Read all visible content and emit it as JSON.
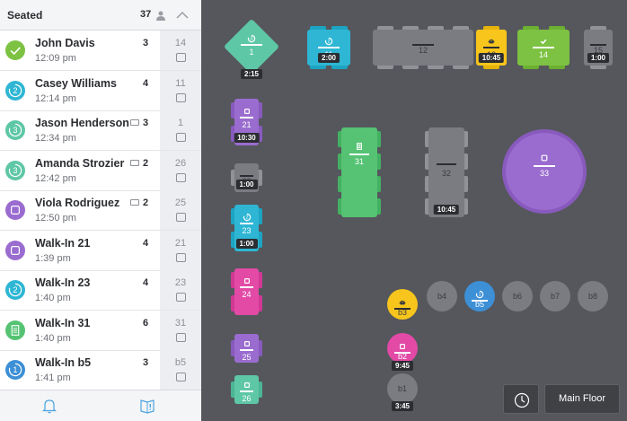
{
  "sidebar": {
    "title": "Seated",
    "guest_count": "37",
    "guests": [
      {
        "name": "John Davis",
        "time": "12:09 pm",
        "party": "3",
        "table": "14",
        "has_note": false,
        "status": "check",
        "color": "#7dc243"
      },
      {
        "name": "Casey Williams",
        "time": "12:14 pm",
        "party": "4",
        "table": "11",
        "has_note": false,
        "status": "course-2",
        "color": "#2eb6d4"
      },
      {
        "name": "Jason Henderson",
        "time": "12:34 pm",
        "party": "3",
        "table": "1",
        "has_note": true,
        "status": "course-3",
        "color": "#5ec7a6"
      },
      {
        "name": "Amanda Strozier",
        "time": "12:42 pm",
        "party": "2",
        "table": "26",
        "has_note": true,
        "status": "course-3",
        "color": "#5ec7a6"
      },
      {
        "name": "Viola Rodriguez",
        "time": "12:50 pm",
        "party": "2",
        "table": "25",
        "has_note": true,
        "status": "empty-plate",
        "color": "#9a6ccf"
      },
      {
        "name": "Walk-In 21",
        "time": "1:39 pm",
        "party": "4",
        "table": "21",
        "has_note": false,
        "status": "empty-plate",
        "color": "#9a6ccf"
      },
      {
        "name": "Walk-In 23",
        "time": "1:40 pm",
        "party": "4",
        "table": "23",
        "has_note": false,
        "status": "course-2",
        "color": "#2eb6d4"
      },
      {
        "name": "Walk-In 31",
        "time": "1:40 pm",
        "party": "6",
        "table": "31",
        "has_note": false,
        "status": "menu",
        "color": "#55c373"
      },
      {
        "name": "Walk-In b5",
        "time": "1:41 pm",
        "party": "3",
        "table": "b5",
        "has_note": false,
        "status": "course-1",
        "color": "#3d8fd6"
      }
    ],
    "footer_icons": [
      "bell-icon",
      "book-alert-icon"
    ]
  },
  "floor": {
    "tables": [
      {
        "id": "1",
        "timer": "2:15",
        "status": "course-3",
        "color": "#5ec7a6"
      },
      {
        "id": "11",
        "timer": "2:00",
        "status": "course-2",
        "color": "#2eb6d4"
      },
      {
        "id": "12",
        "timer": "",
        "status": "empty",
        "color": "#7a7c82"
      },
      {
        "id": "13",
        "timer": "10:45",
        "status": "dessert",
        "color": "#f7c51c"
      },
      {
        "id": "14",
        "timer": "",
        "status": "check",
        "color": "#7dc243"
      },
      {
        "id": "15",
        "timer": "1:00",
        "status": "empty",
        "color": "#7a7c82"
      },
      {
        "id": "21",
        "timer": "10:30",
        "status": "empty-plate",
        "color": "#9a6ccf"
      },
      {
        "id": "22",
        "timer": "1:00",
        "status": "empty",
        "color": "#7a7c82"
      },
      {
        "id": "23",
        "timer": "1:00",
        "status": "course-2",
        "color": "#2eb6d4"
      },
      {
        "id": "24",
        "timer": "",
        "status": "plate",
        "color": "#e24aa6"
      },
      {
        "id": "25",
        "timer": "",
        "status": "plate",
        "color": "#9a6ccf"
      },
      {
        "id": "26",
        "timer": "",
        "status": "plate",
        "color": "#5ec7a6"
      },
      {
        "id": "31",
        "timer": "",
        "status": "menu",
        "color": "#55c373"
      },
      {
        "id": "32",
        "timer": "10:45",
        "status": "empty",
        "color": "#7a7c82"
      },
      {
        "id": "33",
        "timer": "",
        "status": "empty-plate",
        "color": "#9a6ccf"
      },
      {
        "id": "b1",
        "timer": "3:45",
        "status": "empty",
        "color": "#7a7c82"
      },
      {
        "id": "b2",
        "timer": "9:45",
        "status": "empty-plate",
        "color": "#e24aa6"
      },
      {
        "id": "b3",
        "timer": "",
        "status": "dessert",
        "color": "#f7c51c"
      },
      {
        "id": "b4",
        "timer": "",
        "status": "empty",
        "color": "#7a7c82"
      },
      {
        "id": "b5",
        "timer": "",
        "status": "course-1",
        "color": "#3d8fd6"
      },
      {
        "id": "b6",
        "timer": "",
        "status": "empty",
        "color": "#7a7c82"
      },
      {
        "id": "b7",
        "timer": "",
        "status": "empty",
        "color": "#7a7c82"
      },
      {
        "id": "b8",
        "timer": "",
        "status": "empty",
        "color": "#7a7c82"
      }
    ],
    "floor_button_label": "Main Floor",
    "colors": {
      "background": "#55575c",
      "table_empty": "#7a7c82",
      "chair_empty": "#909297"
    }
  }
}
